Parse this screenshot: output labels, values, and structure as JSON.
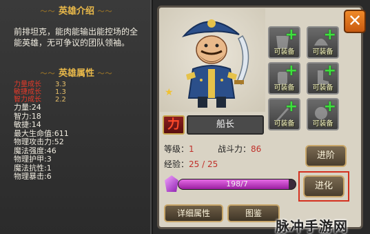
{
  "hero_intro": {
    "title": "英雄介绍",
    "text": "前排坦克，能肉能输出能控场的全能英雄，无可争议的团队领袖。"
  },
  "hero_attributes": {
    "title": "英雄属性",
    "growth": [
      {
        "label": "力量成长",
        "value": "3.3"
      },
      {
        "label": "敏捷成长",
        "value": "1.3"
      },
      {
        "label": "智力成长",
        "value": "2.2"
      }
    ],
    "stats": [
      "力量:24",
      "智力:18",
      "敏捷:14",
      "最大生命值:611",
      "物理攻击力:52",
      "魔法强度:46",
      "物理护甲:3",
      "魔法抗性:1",
      "物理暴击:6"
    ]
  },
  "hero": {
    "badge": "力",
    "name": "船长",
    "level_label": "等级：",
    "level": "1",
    "power_label": "战斗力：",
    "power": "86",
    "exp_label": "经验：",
    "exp": "25 / 25"
  },
  "equip_slots": [
    "可装备",
    "可装备",
    "可装备",
    "可装备",
    "可装备",
    "可装备"
  ],
  "exp_bar": {
    "text": "198/7",
    "fill_fraction": 0.94
  },
  "buttons": {
    "advance": "进阶",
    "evolve": "进化",
    "details": "详细属性",
    "codex": "图鉴"
  },
  "close_icon": "close-icon",
  "watermark": "脉冲手游网",
  "colors": {
    "accent_gold": "#e8b84a",
    "stat_red": "#c0302a",
    "plus_green": "#3de23d",
    "exp_purple": "#9a1ea0"
  }
}
